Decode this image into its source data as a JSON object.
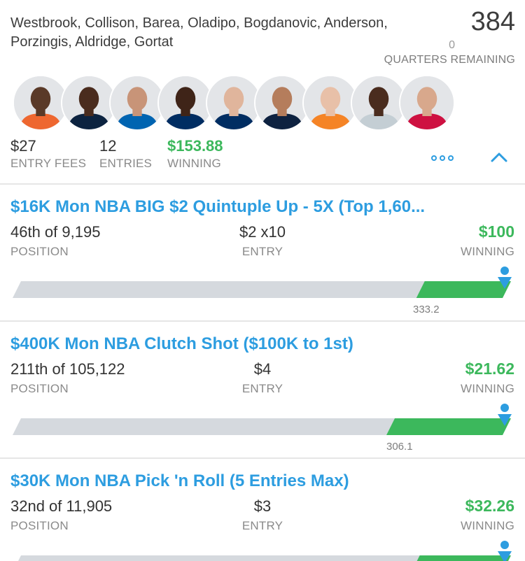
{
  "lineup": {
    "players": "Westbrook, Collison, Barea, Oladipo, Bogdanovic, Anderson, Porzingis, Aldridge, Gortat",
    "score": "384",
    "quarters_remaining_value": "0",
    "quarters_remaining_label": "QUARTERS REMAINING",
    "avatars": [
      {
        "name": "Westbrook",
        "jersey": "#ee6730",
        "skin": "#5a3a28"
      },
      {
        "name": "Collison",
        "jersey": "#0c2340",
        "skin": "#4a2c1e"
      },
      {
        "name": "Barea",
        "jersey": "#0064b1",
        "skin": "#c89478"
      },
      {
        "name": "Oladipo",
        "jersey": "#002d62",
        "skin": "#3f2418"
      },
      {
        "name": "Bogdanovic",
        "jersey": "#002d62",
        "skin": "#e0b59c"
      },
      {
        "name": "Anderson",
        "jersey": "#0e2240",
        "skin": "#b57d5c"
      },
      {
        "name": "Porzingis",
        "jersey": "#f58426",
        "skin": "#e8c0a8"
      },
      {
        "name": "Aldridge",
        "jersey": "#c4ced4",
        "skin": "#4a2c1e"
      },
      {
        "name": "Gortat",
        "jersey": "#ce1141",
        "skin": "#d8a88c"
      }
    ],
    "stats": {
      "entry_fees_value": "$27",
      "entry_fees_label": "ENTRY FEES",
      "entries_value": "12",
      "entries_label": "ENTRIES",
      "winning_value": "$153.88",
      "winning_label": "WINNING"
    },
    "icons": {
      "more": "more-dots-icon",
      "collapse": "chevron-up-icon"
    },
    "colors": {
      "accent": "#2d9de0",
      "green": "#3cb85c",
      "bar_gray": "#d5d9de"
    }
  },
  "contests": [
    {
      "title": "$16K Mon NBA BIG $2 Quintuple Up - 5X (Top 1,60...",
      "position": "46th of 9,195",
      "position_label": "POSITION",
      "entry": "$2 x10",
      "entry_label": "ENTRY",
      "winning": "$100",
      "winning_label": "WINNING",
      "cash_line": "333.2",
      "progress_fraction": 0.81
    },
    {
      "title": "$400K Mon NBA Clutch Shot ($100K to 1st)",
      "position": "211th of 105,122",
      "position_label": "POSITION",
      "entry": "$4",
      "entry_label": "ENTRY",
      "winning": "$21.62",
      "winning_label": "WINNING",
      "cash_line": "306.1",
      "progress_fraction": 0.75
    },
    {
      "title": "$30K Mon NBA Pick 'n Roll (5 Entries Max)",
      "position": "32nd of 11,905",
      "position_label": "POSITION",
      "entry": "$3",
      "entry_label": "ENTRY",
      "winning": "$32.26",
      "winning_label": "WINNING",
      "cash_line": "",
      "progress_fraction": 0.8
    }
  ]
}
